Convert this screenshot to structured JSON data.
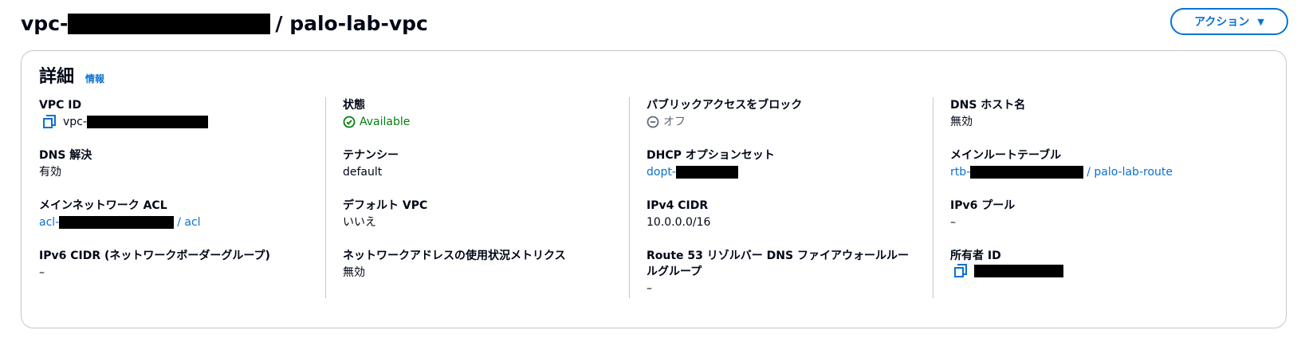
{
  "page": {
    "title_prefix": "vpc-",
    "title_suffix": "/ palo-lab-vpc",
    "actions_label": "アクション"
  },
  "details": {
    "title": "詳細",
    "info_label": "情報",
    "columns": [
      {
        "fields": [
          {
            "label": "VPC ID",
            "value": "vpc-"
          },
          {
            "label": "DNS 解決",
            "value": "有効"
          },
          {
            "label": "メインネットワーク ACL",
            "value_prefix": "acl-",
            "value_suffix": "/ acl"
          },
          {
            "label": "IPv6 CIDR (ネットワークボーダーグループ)",
            "value": "–"
          }
        ]
      },
      {
        "fields": [
          {
            "label": "状態",
            "value": "Available"
          },
          {
            "label": "テナンシー",
            "value": "default"
          },
          {
            "label": "デフォルト VPC",
            "value": "いいえ"
          },
          {
            "label": "ネットワークアドレスの使用状況メトリクス",
            "value": "無効"
          }
        ]
      },
      {
        "fields": [
          {
            "label": "パブリックアクセスをブロック",
            "value": "オフ"
          },
          {
            "label": "DHCP オプションセット",
            "value": "dopt-"
          },
          {
            "label": "IPv4 CIDR",
            "value": "10.0.0.0/16"
          },
          {
            "label": "Route 53 リゾルバー DNS ファイアウォールルールグループ",
            "value": "–"
          }
        ]
      },
      {
        "fields": [
          {
            "label": "DNS ホスト名",
            "value": "無効"
          },
          {
            "label": "メインルートテーブル",
            "value_prefix": "rtb-",
            "value_suffix": "/ palo-lab-route"
          },
          {
            "label": "IPv6 プール",
            "value": "–"
          },
          {
            "label": "所有者 ID",
            "value": ""
          }
        ]
      }
    ]
  },
  "colors": {
    "link": "#0972d3",
    "success": "#037f0c",
    "muted": "#5f6b7a",
    "border": "#c6c6cd"
  },
  "icons": {
    "copy": "copy-icon",
    "available": "check-circle-icon",
    "off": "minus-circle-icon",
    "dropdown": "caret-down-icon"
  }
}
